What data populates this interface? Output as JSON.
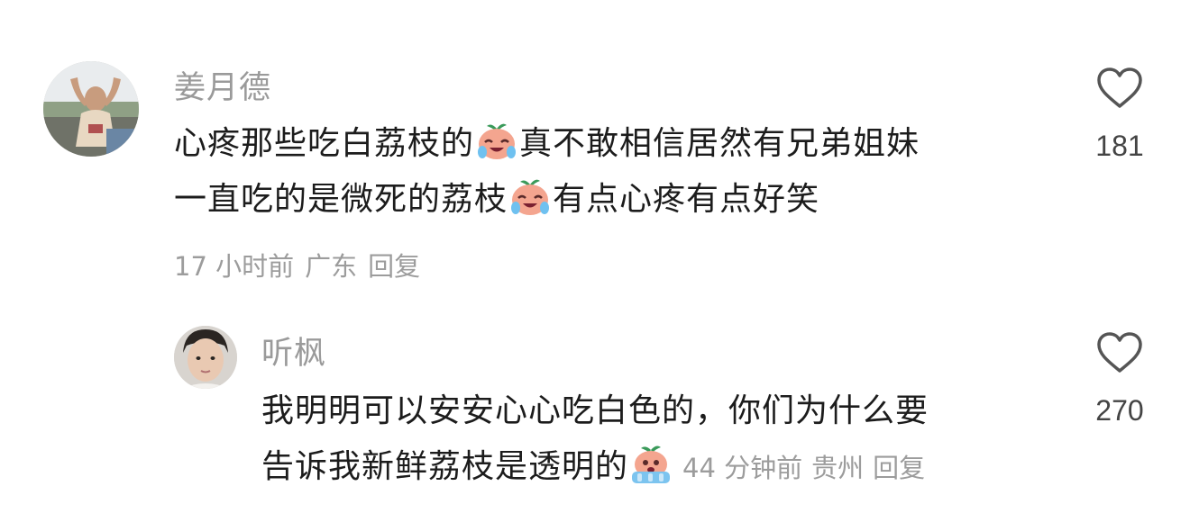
{
  "comments": [
    {
      "username": "姜月德",
      "text_line1_a": "心疼那些吃白荔枝的",
      "text_line1_emoji": "crying-lychee-emoji",
      "text_line1_b": "真不敢相信居然有兄弟姐妹",
      "text_line2_a": "一直吃的是微死的荔枝",
      "text_line2_emoji": "crying-lychee-emoji",
      "text_line2_b": "有点心疼有点好笑",
      "time": "17 小时前",
      "location": "广东",
      "reply_label": "回复",
      "likes": "181"
    },
    {
      "username": "听枫",
      "text_line1": "我明明可以安安心心吃白色的，你们为什么要",
      "text_line2": "告诉我新鲜荔枝是透明的",
      "text_line2_emoji": "scared-lychee-emoji",
      "time": "44 分钟前",
      "location": "贵州",
      "reply_label": "回复",
      "likes": "270"
    }
  ],
  "colors": {
    "username": "#9a9a9a",
    "meta": "#9c9c9c",
    "text": "#1c1c1c",
    "heart_outline": "#555555"
  }
}
